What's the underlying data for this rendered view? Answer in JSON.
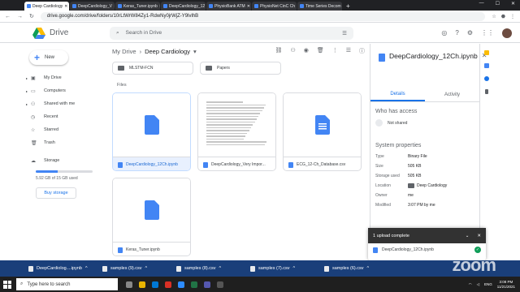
{
  "browser": {
    "tabs": [
      {
        "label": "Deep Cardiology",
        "active": true
      },
      {
        "label": "DeepCardiology_V",
        "active": false
      },
      {
        "label": "Keras_Tuner.ipynb",
        "active": false
      },
      {
        "label": "DeepCardiology_12",
        "active": false
      },
      {
        "label": "PhysioBank ATM",
        "active": false
      },
      {
        "label": "PhysioNet CinC Ch",
        "active": false
      },
      {
        "label": "Time Series Decom",
        "active": false
      }
    ],
    "url": "drive.google.com/drive/folders/10rLtWrW84Zy1-RdwNy0jrWjZ-Y9lvlhB"
  },
  "header": {
    "app_name": "Drive",
    "search_placeholder": "Search in Drive"
  },
  "sidebar": {
    "new_label": "New",
    "items": [
      {
        "label": "My Drive",
        "icon": "drive-icon"
      },
      {
        "label": "Computers",
        "icon": "computer-icon"
      },
      {
        "label": "Shared with me",
        "icon": "people-icon"
      },
      {
        "label": "Recent",
        "icon": "clock-icon"
      },
      {
        "label": "Starred",
        "icon": "star-icon"
      },
      {
        "label": "Trash",
        "icon": "trash-icon"
      }
    ],
    "storage_label": "Storage",
    "storage_text": "5.92 GB of 15 GB used",
    "storage_fraction": 0.39,
    "buy_label": "Buy storage"
  },
  "main": {
    "breadcrumb_root": "My Drive",
    "breadcrumb_current": "Deep Cardiology",
    "folders": [
      "MLSTM-FCN",
      "Papers"
    ],
    "files_heading": "Files",
    "files": [
      {
        "name": "DeepCardiology_12Ch.ipynb",
        "selected": true,
        "kind": "doc"
      },
      {
        "name": "DeepCardiology_Very Impor...",
        "selected": false,
        "kind": "preview"
      },
      {
        "name": "ECG_12-Ch_Database.csv",
        "selected": false,
        "kind": "lines"
      },
      {
        "name": "Keras_Tuner.ipynb",
        "selected": false,
        "kind": "doc"
      }
    ]
  },
  "details": {
    "title": "DeepCardiology_12Ch.ipynb",
    "tab_details": "Details",
    "tab_activity": "Activity",
    "access_heading": "Who has access",
    "access_status": "Not shared",
    "props_heading": "System properties",
    "props": [
      {
        "k": "Type",
        "v": "Binary File"
      },
      {
        "k": "Size",
        "v": "505 KB"
      },
      {
        "k": "Storage used",
        "v": "505 KB"
      },
      {
        "k": "Location",
        "v": "Deep Cardiology"
      },
      {
        "k": "Owner",
        "v": "me"
      },
      {
        "k": "Modified",
        "v": "3:07 PM by me"
      }
    ]
  },
  "toast": {
    "title": "1 upload complete",
    "file": "DeepCardiology_12Ch.ipynb"
  },
  "downloads": [
    "DeepCardiolog....ipynb",
    "samples (9).csv",
    "samples (8).csv",
    "samples (7).csv",
    "samples (6).csv"
  ],
  "overlay_logo": "zoom",
  "taskbar": {
    "search_placeholder": "Type here to search",
    "lang": "ENG",
    "time": "3:08 PM",
    "date": "11/21/2021"
  }
}
